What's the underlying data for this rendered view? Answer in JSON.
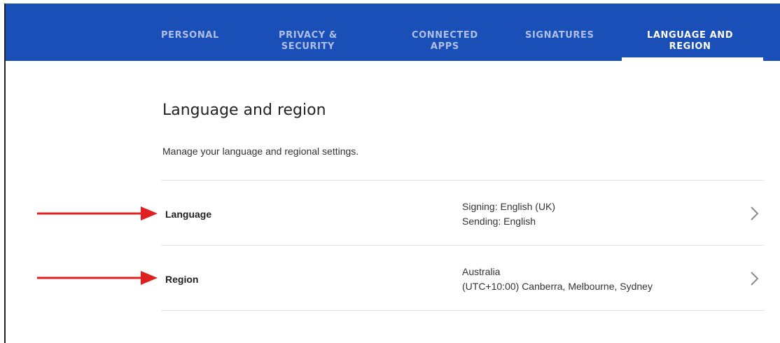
{
  "nav": {
    "tabs": [
      {
        "label": "PERSONAL",
        "active": false
      },
      {
        "label": "PRIVACY &\nSECURITY",
        "active": false
      },
      {
        "label": "CONNECTED\nAPPS",
        "active": false
      },
      {
        "label": "SIGNATURES",
        "active": false
      },
      {
        "label": "LANGUAGE AND\nREGION",
        "active": true
      }
    ]
  },
  "main": {
    "title": "Language and region",
    "description": "Manage your language and regional settings.",
    "rows": [
      {
        "label": "Language",
        "value_line1": "Signing: English (UK)",
        "value_line2": "Sending: English"
      },
      {
        "label": "Region",
        "value_line1": "Australia",
        "value_line2": "(UTC+10:00) Canberra, Melbourne, Sydney"
      }
    ]
  },
  "colors": {
    "header_bg": "#1a4fb8",
    "annotation_arrow": "#e02020"
  },
  "icons": {
    "chevron": "chevron-right-icon",
    "annotation": "red-arrow-icon"
  }
}
